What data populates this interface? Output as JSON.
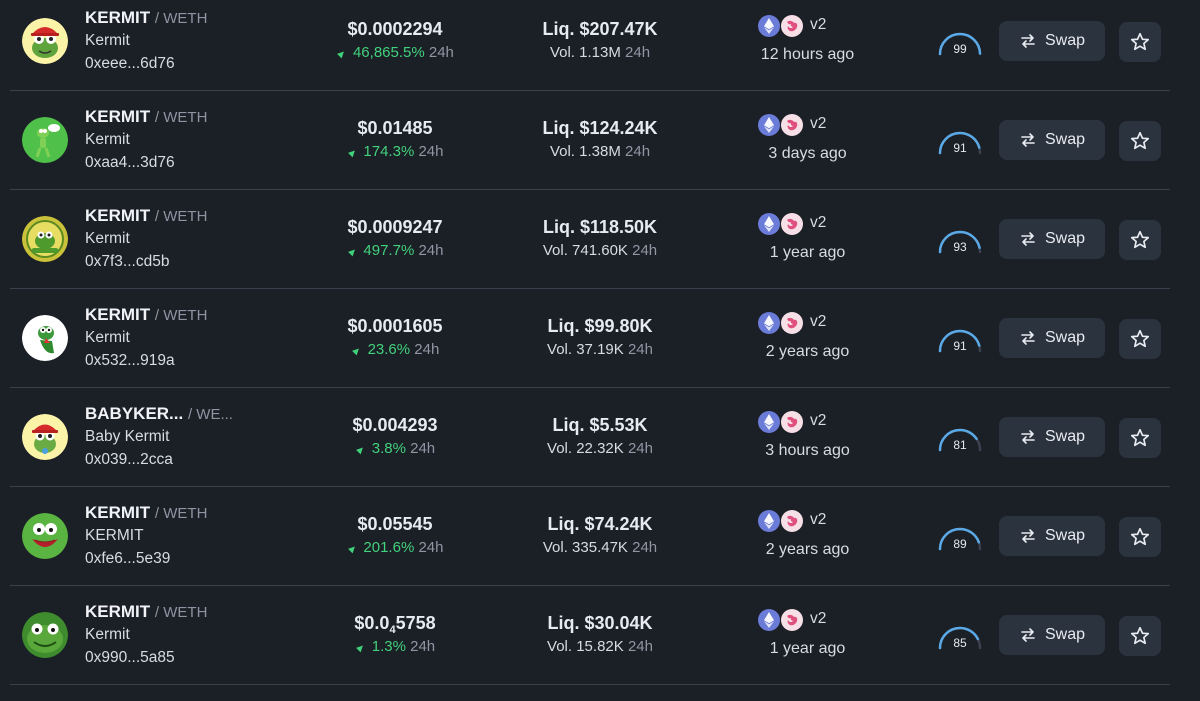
{
  "swap_label": "Swap",
  "colors": {
    "background": "#1b1f26",
    "positive": "#42d17c",
    "button": "#2b333f",
    "gauge": "#5aa9e6"
  },
  "rows": [
    {
      "symbol": "KERMIT",
      "pair": "/ WETH",
      "name": "Kermit",
      "address": "0xeee...6d76",
      "price_main": "$0.0002294",
      "price_sub": "",
      "price_tail": "",
      "change": "46,865.5%",
      "change_period": "24h",
      "liquidity": "Liq. $207.47K",
      "volume": "Vol. 1.13M",
      "volume_period": "24h",
      "dex_version": "v2",
      "age": "12 hours ago",
      "score": "99",
      "score_fraction": 0.99,
      "avatar": "kermit-maga-hat"
    },
    {
      "symbol": "KERMIT",
      "pair": "/ WETH",
      "name": "Kermit",
      "address": "0xaa4...3d76",
      "price_main": "$0.01485",
      "price_sub": "",
      "price_tail": "",
      "change": "174.3%",
      "change_period": "24h",
      "liquidity": "Liq. $124.24K",
      "volume": "Vol. 1.38M",
      "volume_period": "24h",
      "dex_version": "v2",
      "age": "3 days ago",
      "score": "91",
      "score_fraction": 0.91,
      "avatar": "kermit-standing"
    },
    {
      "symbol": "KERMIT",
      "pair": "/ WETH",
      "name": "Kermit",
      "address": "0x7f3...cd5b",
      "price_main": "$0.0009247",
      "price_sub": "",
      "price_tail": "",
      "change": "497.7%",
      "change_period": "24h",
      "liquidity": "Liq. $118.50K",
      "volume": "Vol. 741.60K",
      "volume_period": "24h",
      "dex_version": "v2",
      "age": "1 year ago",
      "score": "93",
      "score_fraction": 0.93,
      "avatar": "kermit-coin"
    },
    {
      "symbol": "KERMIT",
      "pair": "/ WETH",
      "name": "Kermit",
      "address": "0x532...919a",
      "price_main": "$0.0001605",
      "price_sub": "",
      "price_tail": "",
      "change": "23.6%",
      "change_period": "24h",
      "liquidity": "Liq. $99.80K",
      "volume": "Vol. 37.19K",
      "volume_period": "24h",
      "dex_version": "v2",
      "age": "2 years ago",
      "score": "91",
      "score_fraction": 0.91,
      "avatar": "kermit-white"
    },
    {
      "symbol": "BABYKER...",
      "pair": "/ WE...",
      "name": "Baby Kermit",
      "address": "0x039...2cca",
      "price_main": "$0.004293",
      "price_sub": "",
      "price_tail": "",
      "change": "3.8%",
      "change_period": "24h",
      "liquidity": "Liq. $5.53K",
      "volume": "Vol. 22.32K",
      "volume_period": "24h",
      "dex_version": "v2",
      "age": "3 hours ago",
      "score": "81",
      "score_fraction": 0.81,
      "avatar": "baby-kermit-hat"
    },
    {
      "symbol": "KERMIT",
      "pair": "/ WETH",
      "name": "KERMIT",
      "address": "0xfe6...5e39",
      "price_main": "$0.05545",
      "price_sub": "",
      "price_tail": "",
      "change": "201.6%",
      "change_period": "24h",
      "liquidity": "Liq. $74.24K",
      "volume": "Vol. 335.47K",
      "volume_period": "24h",
      "dex_version": "v2",
      "age": "2 years ago",
      "score": "89",
      "score_fraction": 0.89,
      "avatar": "kermit-face"
    },
    {
      "symbol": "KERMIT",
      "pair": "/ WETH",
      "name": "Kermit",
      "address": "0x990...5a85",
      "price_main": "$0.0",
      "price_sub": "4",
      "price_tail": "5758",
      "change": "1.3%",
      "change_period": "24h",
      "liquidity": "Liq. $30.04K",
      "volume": "Vol. 15.82K",
      "volume_period": "24h",
      "dex_version": "v2",
      "age": "1 year ago",
      "score": "85",
      "score_fraction": 0.85,
      "avatar": "kermit-close"
    }
  ]
}
